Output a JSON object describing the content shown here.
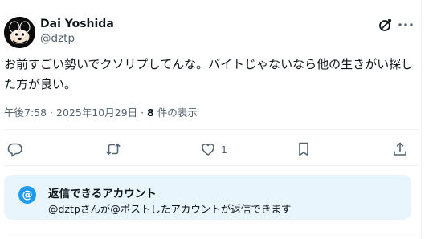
{
  "author": {
    "display_name": "Dai Yoshida",
    "handle": "@dztp"
  },
  "post": {
    "text": "お前すごい勢いでクソリプしてんな。バイトじゃないなら他の生きがい探した方が良い。",
    "time": "午後7:58 · 2025年10月29日 · ",
    "views_count": "8",
    "views_suffix": " 件の表示"
  },
  "actions": {
    "reply_count": "",
    "repost_count": "",
    "like_count": "1"
  },
  "reply_restriction": {
    "badge": "@",
    "title": "返信できるアカウント",
    "description": "@dztpさんが@ポストしたアカウントが返信できます"
  },
  "colors": {
    "accent": "#1d9bf0",
    "muted": "#536471",
    "info_bg": "#e8f5fd"
  },
  "icons": [
    "grok-icon",
    "more-icon",
    "reply-icon",
    "repost-icon",
    "like-icon",
    "bookmark-icon",
    "share-icon"
  ]
}
